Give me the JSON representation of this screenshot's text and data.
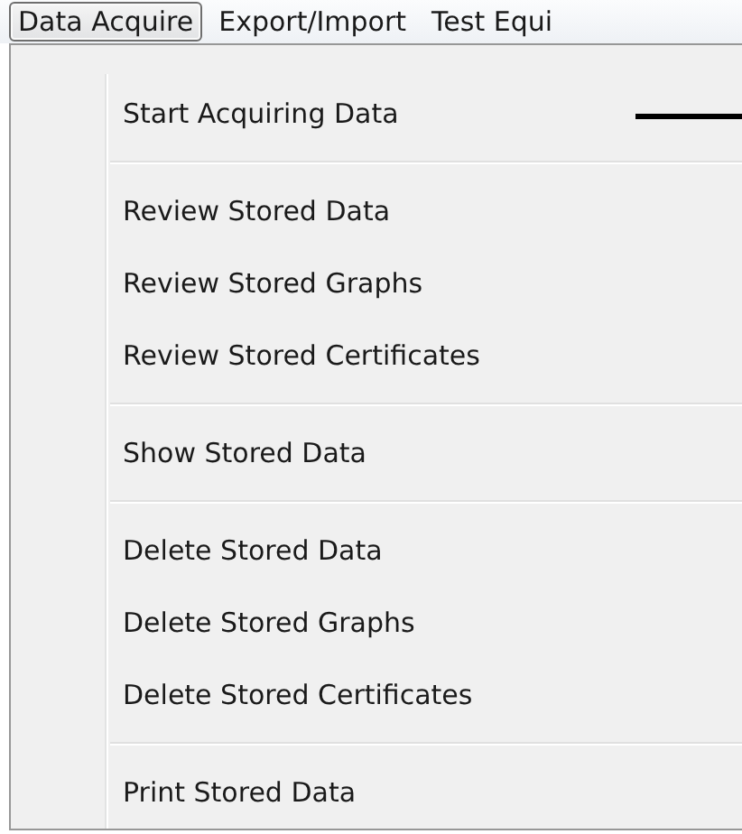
{
  "menu_bar": {
    "items": [
      {
        "label": "Data Acquire",
        "selected": true
      },
      {
        "label": "Export/Import",
        "selected": false
      },
      {
        "label": "Test Equi",
        "selected": false
      }
    ]
  },
  "menu": {
    "items": [
      {
        "kind": "item",
        "label": "Start Acquiring Data"
      },
      {
        "kind": "separator"
      },
      {
        "kind": "item",
        "label": "Review Stored Data"
      },
      {
        "kind": "item",
        "label": "Review Stored Graphs"
      },
      {
        "kind": "item",
        "label": "Review Stored Certificates"
      },
      {
        "kind": "separator"
      },
      {
        "kind": "item",
        "label": "Show Stored Data"
      },
      {
        "kind": "separator"
      },
      {
        "kind": "item",
        "label": "Delete Stored Data"
      },
      {
        "kind": "item",
        "label": "Delete Stored Graphs"
      },
      {
        "kind": "item",
        "label": "Delete Stored Certificates"
      },
      {
        "kind": "separator"
      },
      {
        "kind": "item",
        "label": "Print Stored Data"
      }
    ]
  }
}
